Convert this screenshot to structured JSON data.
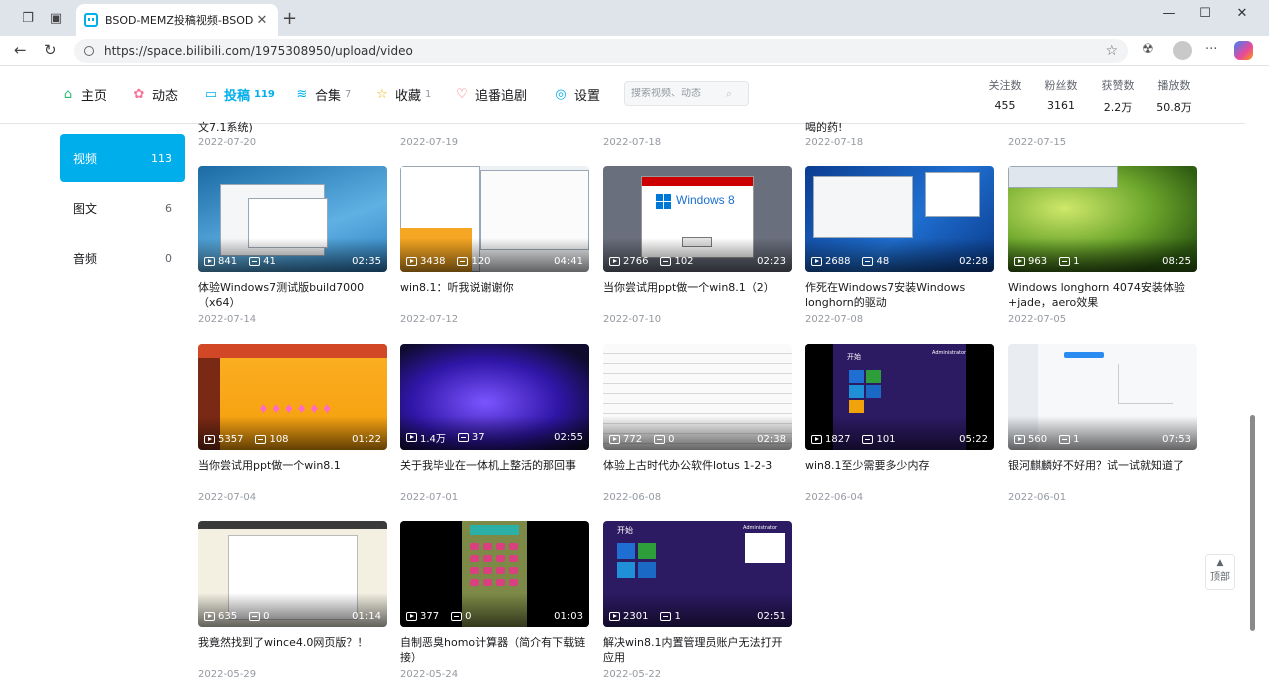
{
  "browser": {
    "tab_title": "BSOD-MEMZ投稿视频-BSOD-ME",
    "url": "https://space.bilibili.com/1975308950/upload/video"
  },
  "nav": {
    "home": "主页",
    "dynamic": "动态",
    "uploads": "投稿",
    "uploads_count": "119",
    "collections": "合集",
    "collections_count": "7",
    "favorites": "收藏",
    "favorites_count": "1",
    "bangumi": "追番追剧",
    "settings": "设置",
    "search_placeholder": "搜索视频、动态"
  },
  "stats": [
    {
      "label": "关注数",
      "value": "455"
    },
    {
      "label": "粉丝数",
      "value": "3161"
    },
    {
      "label": "获赞数",
      "value": "2.2万"
    },
    {
      "label": "播放数",
      "value": "50.8万"
    }
  ],
  "sidebar": [
    {
      "label": "视频",
      "count": "113"
    },
    {
      "label": "图文",
      "count": "6"
    },
    {
      "label": "音频",
      "count": "0"
    }
  ],
  "top_row": [
    {
      "title": "文7.1系统)",
      "date": "2022-07-20"
    },
    {
      "title": "",
      "date": "2022-07-19"
    },
    {
      "title": "",
      "date": "2022-07-18"
    },
    {
      "title": "喝的药!",
      "date": "2022-07-18"
    },
    {
      "title": "",
      "date": "2022-07-15"
    }
  ],
  "videos": [
    {
      "title": "体验Windows7测试版build7000（x64）",
      "date": "2022-07-14",
      "plays": "841",
      "danmaku": "41",
      "duration": "02:35"
    },
    {
      "title": "win8.1：听我说谢谢你",
      "date": "2022-07-12",
      "plays": "3438",
      "danmaku": "120",
      "duration": "04:41"
    },
    {
      "title": "当你尝试用ppt做一个win8.1（2）",
      "date": "2022-07-10",
      "plays": "2766",
      "danmaku": "102",
      "duration": "02:23"
    },
    {
      "title": "作死在Windows7安装Windows longhorn的驱动",
      "date": "2022-07-08",
      "plays": "2688",
      "danmaku": "48",
      "duration": "02:28"
    },
    {
      "title": "Windows longhorn 4074安装体验+jade，aero效果",
      "date": "2022-07-05",
      "plays": "963",
      "danmaku": "1",
      "duration": "08:25"
    },
    {
      "title": "当你尝试用ppt做一个win8.1",
      "date": "2022-07-04",
      "plays": "5357",
      "danmaku": "108",
      "duration": "01:22"
    },
    {
      "title": "关于我毕业在一体机上整活的那回事",
      "date": "2022-07-01",
      "plays": "1.4万",
      "danmaku": "37",
      "duration": "02:55"
    },
    {
      "title": "体验上古时代办公软件lotus 1-2-3",
      "date": "2022-06-08",
      "plays": "772",
      "danmaku": "0",
      "duration": "02:38"
    },
    {
      "title": "win8.1至少需要多少内存",
      "date": "2022-06-04",
      "plays": "1827",
      "danmaku": "101",
      "duration": "05:22"
    },
    {
      "title": "银河麒麟好不好用？试一试就知道了",
      "date": "2022-06-01",
      "plays": "560",
      "danmaku": "1",
      "duration": "07:53"
    },
    {
      "title": "我竟然找到了wince4.0网页版？！",
      "date": "2022-05-29",
      "plays": "635",
      "danmaku": "0",
      "duration": "01:14"
    },
    {
      "title": "自制恶臭homo计算器（简介有下载链接）",
      "date": "2022-05-24",
      "plays": "377",
      "danmaku": "0",
      "duration": "01:03"
    },
    {
      "title": "解决win8.1内置管理员账户无法打开应用",
      "date": "2022-05-22",
      "plays": "2301",
      "danmaku": "1",
      "duration": "02:51"
    }
  ],
  "thumb_text": {
    "win8": "Windows 8",
    "start": "开始",
    "admin": "Administrator"
  },
  "back_to_top": "顶部",
  "colors": {
    "accent": "#00aeec",
    "text": "#18191c",
    "muted": "#9499a0"
  }
}
